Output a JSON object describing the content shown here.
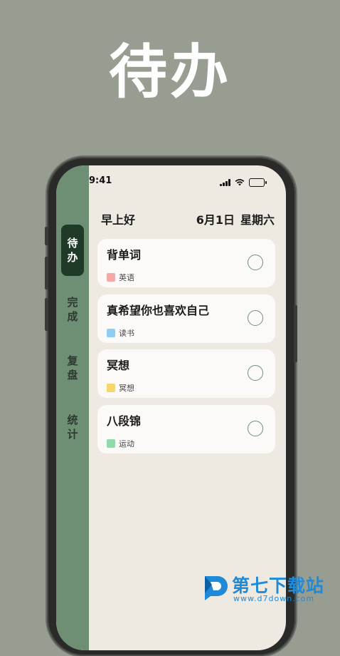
{
  "headline": "待办",
  "status_bar": {
    "time": "9:41"
  },
  "sidebar": {
    "items": [
      {
        "chars": [
          "待",
          "办"
        ],
        "active": true
      },
      {
        "chars": [
          "完",
          "成"
        ],
        "active": false
      },
      {
        "chars": [
          "复",
          "盘"
        ],
        "active": false
      },
      {
        "chars": [
          "统",
          "计"
        ],
        "active": false
      }
    ]
  },
  "header": {
    "greeting": "早上好",
    "date": "6月1日",
    "weekday": "星期六"
  },
  "tasks": [
    {
      "title": "背单词",
      "tag": "英语",
      "tag_color": "#f4a9a8"
    },
    {
      "title": "真希望你也喜欢自己",
      "tag": "读书",
      "tag_color": "#8ecdf5"
    },
    {
      "title": "冥想",
      "tag": "冥想",
      "tag_color": "#f7d66a"
    },
    {
      "title": "八段锦",
      "tag": "运动",
      "tag_color": "#8fdcaa"
    }
  ],
  "colors": {
    "accent": "#6f8f75",
    "accent_dark": "#1f3a26",
    "watermark_blue": "#1e8ad8"
  },
  "watermark": {
    "name": "第七下载站",
    "url": "www.d7down.com"
  }
}
